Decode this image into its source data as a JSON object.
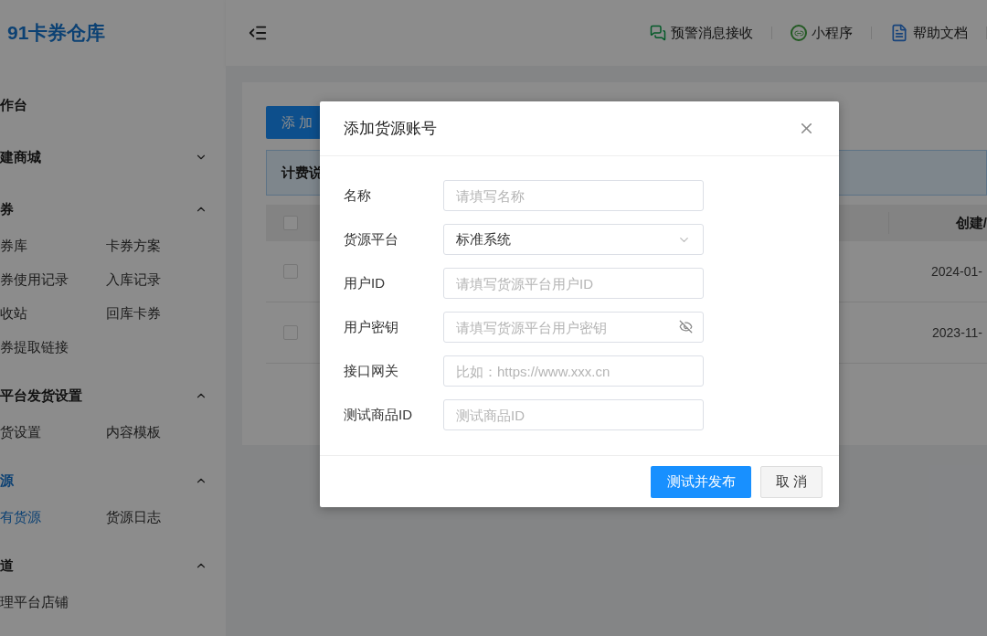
{
  "sidebar": {
    "logo": "91卡券仓库",
    "sections": [
      {
        "label": "作台",
        "kind": "link",
        "selected": false
      },
      {
        "label": "建商城",
        "kind": "group",
        "expanded": false,
        "selected": false
      },
      {
        "label": "券",
        "kind": "group",
        "expanded": true,
        "selected": false,
        "children": [
          {
            "label": "券库",
            "selected": false
          },
          {
            "label": "卡券方案",
            "selected": false
          },
          {
            "label": "券使用记录",
            "selected": false
          },
          {
            "label": "入库记录",
            "selected": false
          },
          {
            "label": "收站",
            "selected": false
          },
          {
            "label": "回库卡券",
            "selected": false
          },
          {
            "label": "券提取链接",
            "selected": false
          }
        ]
      },
      {
        "label": "平台发货设置",
        "kind": "group",
        "expanded": true,
        "selected": false,
        "children": [
          {
            "label": "货设置",
            "selected": false
          },
          {
            "label": "内容模板",
            "selected": false
          }
        ]
      },
      {
        "label": "源",
        "kind": "group",
        "expanded": true,
        "selected": true,
        "children": [
          {
            "label": "有货源",
            "selected": true
          },
          {
            "label": "货源日志",
            "selected": false
          }
        ]
      },
      {
        "label": "道",
        "kind": "group",
        "expanded": true,
        "selected": false,
        "children": [
          {
            "label": "理平台店铺",
            "selected": false
          }
        ]
      }
    ]
  },
  "header": {
    "links": [
      {
        "label": "预警消息接收",
        "kind": "chat"
      },
      {
        "label": "小程序",
        "kind": "miniapp"
      },
      {
        "label": "帮助文档",
        "kind": "doc"
      }
    ]
  },
  "content": {
    "add_button": "添 加",
    "notice": "计费说",
    "table": {
      "header_checked": false,
      "columns": [
        "创建/"
      ],
      "rows": [
        {
          "checked": false,
          "created": "2024-01-"
        },
        {
          "checked": false,
          "created": "2023-11-"
        }
      ]
    }
  },
  "modal": {
    "title": "添加货源账号",
    "fields": [
      {
        "label": "名称",
        "kind": "text",
        "placeholder": "请填写名称"
      },
      {
        "label": "货源平台",
        "kind": "select",
        "value": "标准系统"
      },
      {
        "label": "用户ID",
        "kind": "text",
        "placeholder": "请填写货源平台用户ID"
      },
      {
        "label": "用户密钥",
        "kind": "password",
        "placeholder": "请填写货源平台用户密钥"
      },
      {
        "label": "接口网关",
        "kind": "text",
        "placeholder": "比如：https://www.xxx.cn"
      },
      {
        "label": "测试商品ID",
        "kind": "text",
        "placeholder": "测试商品ID"
      }
    ],
    "buttons": [
      {
        "label": "测试并发布",
        "kind": "primary"
      },
      {
        "label": "取 消",
        "kind": "default"
      }
    ]
  }
}
